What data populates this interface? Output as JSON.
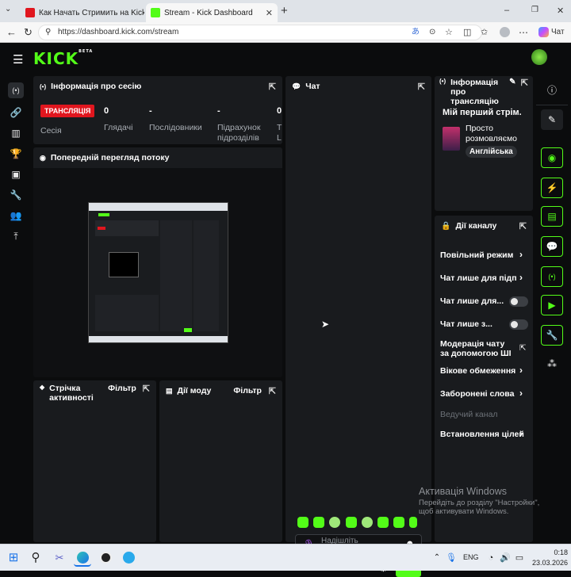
{
  "browser": {
    "tabs": [
      {
        "title": "Как Начать Стримить на Kick чер",
        "active": false
      },
      {
        "title": "Stream - Kick Dashboard",
        "active": true
      }
    ],
    "url": "https://dashboard.kick.com/stream",
    "window_controls": [
      "–",
      "❐",
      "✕"
    ]
  },
  "app": {
    "logo": "KICK",
    "logo_badge": "BETA"
  },
  "session": {
    "title": "Інформація про сесію",
    "live_badge": "ТРАНСЛЯЦІЯ",
    "session_label": "Сесія",
    "stats": [
      {
        "value": "0",
        "label": "Глядачі"
      },
      {
        "value": "-",
        "label": "Послідовники"
      },
      {
        "value": "-",
        "label": "Підрахунок підрозділів"
      },
      {
        "value": "0",
        "label": "Т\nL"
      }
    ]
  },
  "preview": {
    "title": "Попередній перегляд потоку"
  },
  "chat": {
    "title": "Чат",
    "placeholder": "Надішліть повідомлення",
    "send_label": "Чат"
  },
  "stream_info": {
    "title": "Інформація про трансляцію",
    "stream_title": "Мій перший стрім.",
    "category": "Просто розмовляємо",
    "language": "Англійська"
  },
  "channel_actions": {
    "title": "Дії каналу",
    "items": [
      {
        "label": "Повільний режим",
        "control": "chevron"
      },
      {
        "label": "Чат лише для підпис",
        "control": "chevron"
      },
      {
        "label": "Чат лише для...",
        "control": "toggle"
      },
      {
        "label": "Чат лише з...",
        "control": "toggle"
      },
      {
        "label": "Модерація чату за допомогою ШІ",
        "control": "external"
      },
      {
        "label": "Вікове обмеження р",
        "control": "chevron"
      },
      {
        "label": "Заборонені слова",
        "control": "chevron"
      },
      {
        "label": "Ведучий канал",
        "control": "none",
        "disabled": true
      },
      {
        "label": "Встановлення цілей",
        "control": "chevron"
      }
    ]
  },
  "activity": {
    "title": "Стрічка активності",
    "filter": "Фільтр"
  },
  "mod_actions": {
    "title": "Дії моду",
    "filter": "Фільтр"
  },
  "windows_activation": {
    "title": "Активація Windows",
    "line1": "Перейдіть до розділу \"Настройки\",",
    "line2": "щоб активувати Windows."
  },
  "taskbar": {
    "lang": "ENG",
    "time": "0:18",
    "date": "23.03.2026"
  },
  "colors": {
    "accent": "#53fc18",
    "live": "#e0161e",
    "panel": "#191b1e",
    "background": "#0b0c0d"
  }
}
